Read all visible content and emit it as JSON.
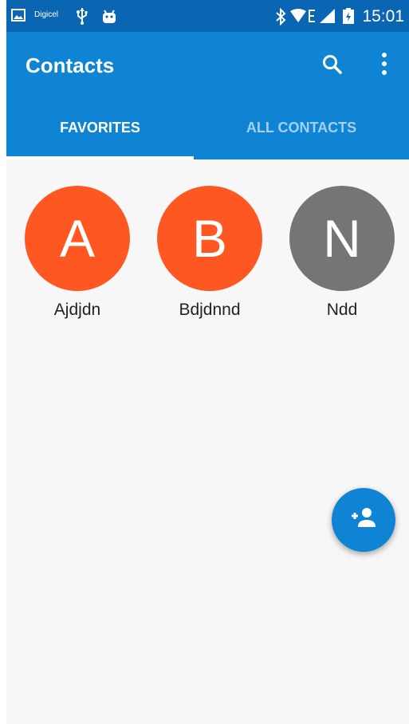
{
  "status_bar": {
    "carrier": "Digicel",
    "time": "15:01",
    "icons": [
      "gallery-icon",
      "usb-icon",
      "android-debug-icon",
      "bluetooth-icon",
      "wifi-icon",
      "edge-network-icon",
      "signal-icon",
      "battery-charging-icon"
    ]
  },
  "app_bar": {
    "title": "Contacts",
    "actions": [
      "search-icon",
      "more-vert-icon"
    ]
  },
  "tabs": [
    {
      "label": "FAVORITES",
      "selected": true
    },
    {
      "label": "ALL CONTACTS",
      "selected": false
    }
  ],
  "favorites": [
    {
      "initial": "A",
      "name": "Ajdjdn",
      "color": "#ff5722"
    },
    {
      "initial": "B",
      "name": "Bdjdnnd",
      "color": "#ff5722"
    },
    {
      "initial": "N",
      "name": "Ndd",
      "color": "#757575"
    }
  ],
  "fab": {
    "icon": "add-contact-icon"
  },
  "colors": {
    "status_bar": "#0a66b3",
    "app_bar": "#0f83d4",
    "background": "#f7f7f7",
    "fab": "#0f83d4"
  }
}
